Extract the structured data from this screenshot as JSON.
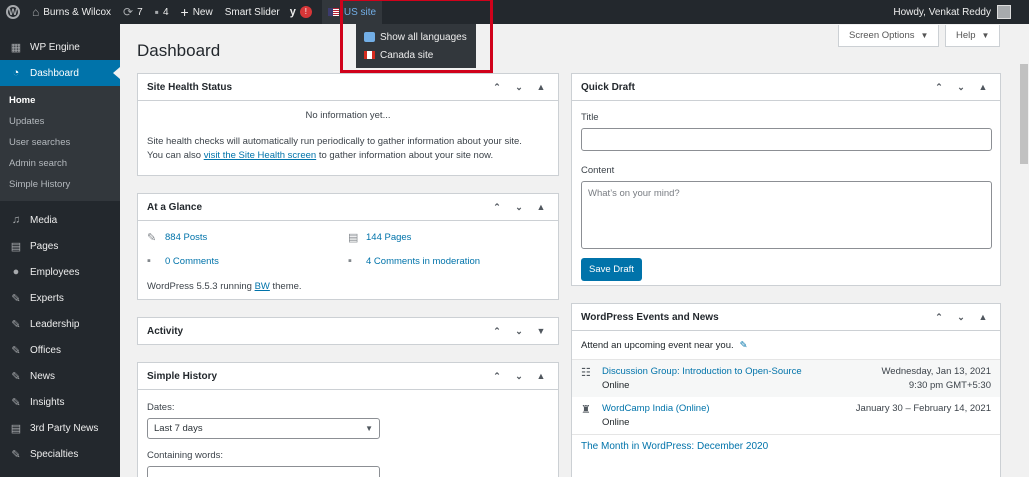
{
  "adminbar": {
    "site_name": "Burns & Wilcox",
    "updates_count": "7",
    "comments_count": "4",
    "new_label": "New",
    "smart_slider": "Smart Slider",
    "language_label": "US site",
    "greeting": "Howdy, Venkat Reddy"
  },
  "language_menu": {
    "items": [
      {
        "label": "Show all languages"
      },
      {
        "label": "Canada site"
      }
    ]
  },
  "sidebar": {
    "wp_engine": "WP Engine",
    "dashboard": "Dashboard",
    "submenu": [
      "Home",
      "Updates",
      "User searches",
      "Admin search",
      "Simple History"
    ],
    "items": [
      "Media",
      "Pages",
      "Employees",
      "Experts",
      "Leadership",
      "Offices",
      "News",
      "Insights",
      "3rd Party News",
      "Specialties"
    ]
  },
  "page": {
    "title": "Dashboard",
    "screen_options": "Screen Options",
    "help": "Help"
  },
  "site_health": {
    "title": "Site Health Status",
    "no_info": "No information yet...",
    "text1": "Site health checks will automatically run periodically to gather information about your site.",
    "text2a": "You can also ",
    "link": "visit the Site Health screen",
    "text2b": " to gather information about your site now."
  },
  "glance": {
    "title": "At a Glance",
    "posts": "884 Posts",
    "pages": "144 Pages",
    "comments": "0 Comments",
    "moderation": "4 Comments in moderation",
    "version_a": "WordPress 5.5.3 running ",
    "theme": "BW",
    "version_b": " theme."
  },
  "activity": {
    "title": "Activity"
  },
  "simple_history": {
    "title": "Simple History",
    "dates_label": "Dates:",
    "dates_value": "Last 7 days",
    "containing_label": "Containing words:"
  },
  "quick_draft": {
    "title": "Quick Draft",
    "title_label": "Title",
    "content_label": "Content",
    "content_placeholder": "What’s on your mind?",
    "save_button": "Save Draft"
  },
  "events": {
    "title": "WordPress Events and News",
    "attend": "Attend an upcoming event near you.",
    "list": [
      {
        "name": "Discussion Group: Introduction to Open-Source",
        "location": "Online",
        "date": "Wednesday, Jan 13, 2021",
        "time": "9:30 pm GMT+5:30"
      },
      {
        "name": "WordCamp India (Online)",
        "location": "Online",
        "date": "January 30 – February 14, 2021",
        "time": ""
      }
    ],
    "news_link": "The Month in WordPress: December 2020"
  }
}
